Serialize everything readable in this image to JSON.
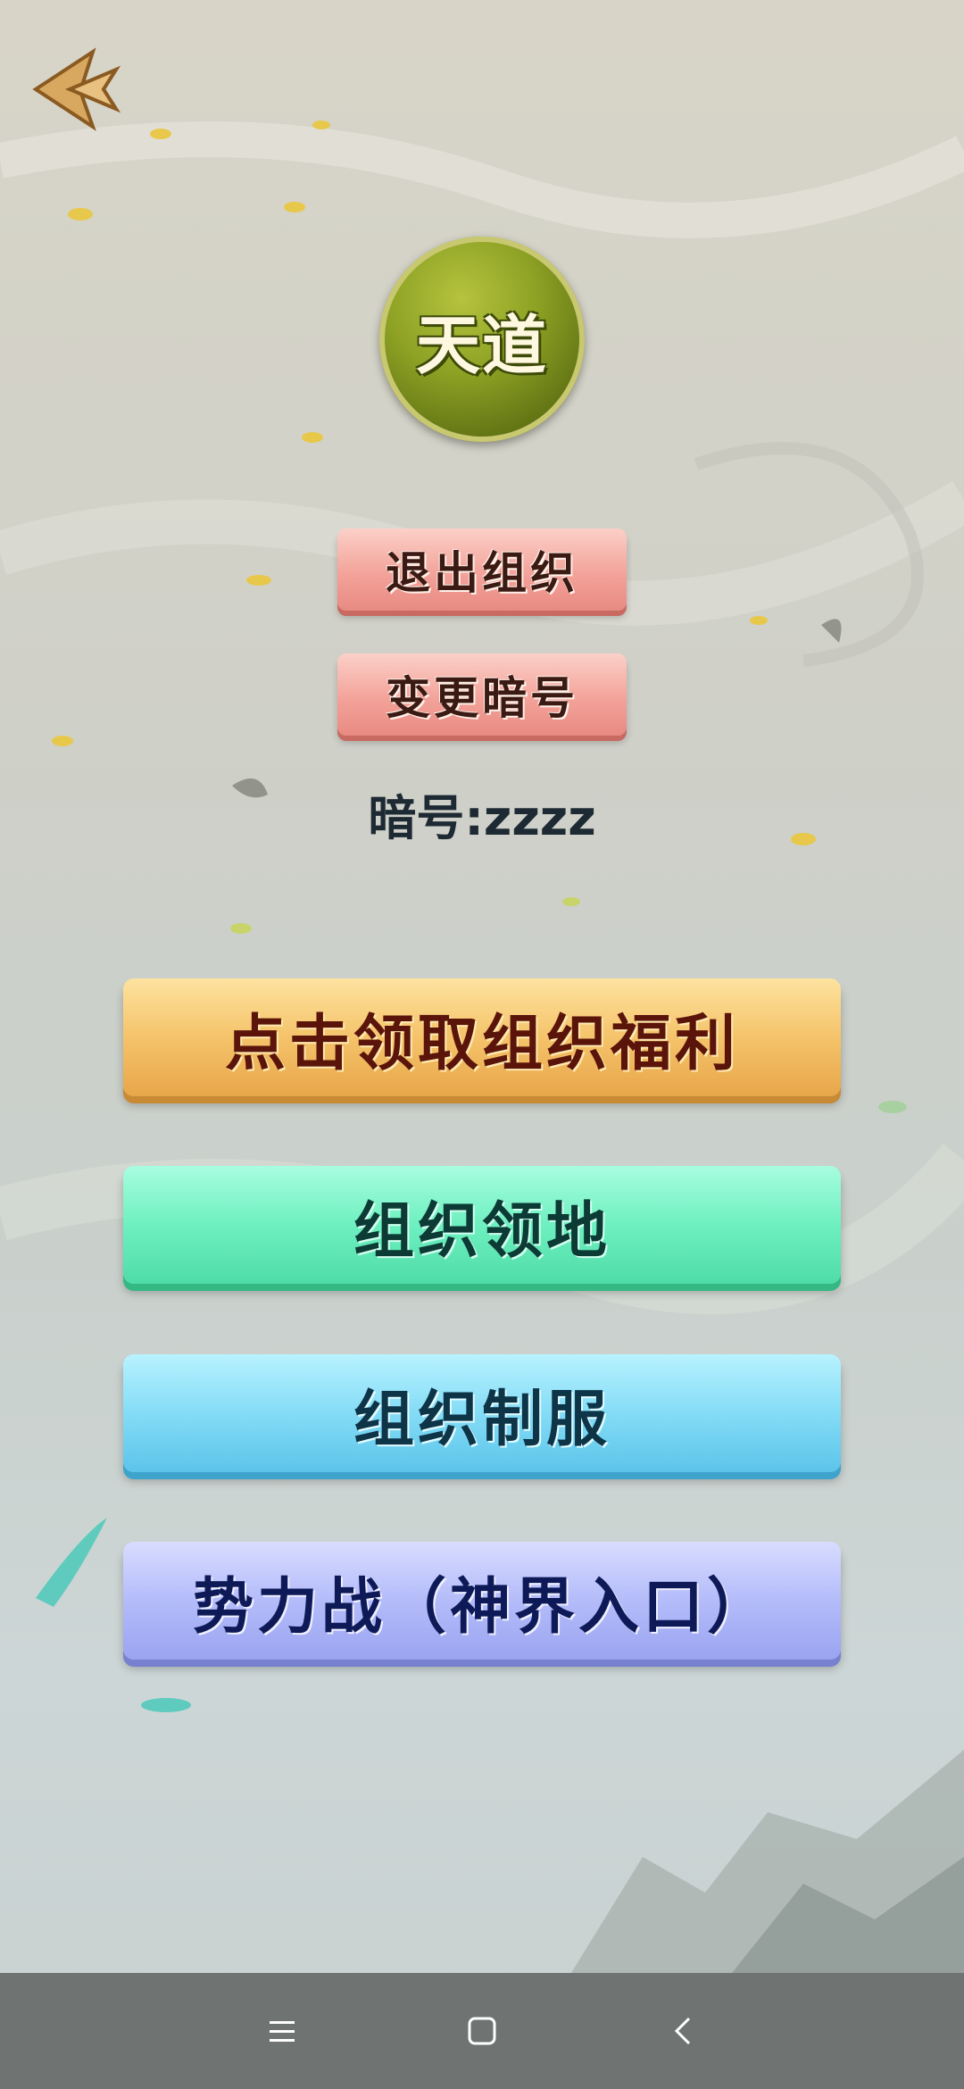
{
  "header": {
    "back_icon": "back-arrow-icon"
  },
  "emblem": {
    "text": "天道"
  },
  "actions": {
    "quit_label": "退出组织",
    "change_code_label": "变更暗号"
  },
  "code": {
    "text": "暗号:zzzz"
  },
  "menu": {
    "welfare_label": "点击领取组织福利",
    "territory_label": "组织领地",
    "uniform_label": "组织制服",
    "war_label": "势力战（神界入口）"
  },
  "navbar": {
    "menu_icon": "menu-icon",
    "home_icon": "home-square-icon",
    "back_icon": "back-chevron-icon"
  },
  "colors": {
    "welfare": "#f5c36a",
    "territory": "#6ef0c0",
    "uniform": "#84dcf6",
    "war": "#b4bcfa",
    "pink_button": "#f3a39a",
    "emblem": "#8da124",
    "navbar": "#6f7473"
  }
}
